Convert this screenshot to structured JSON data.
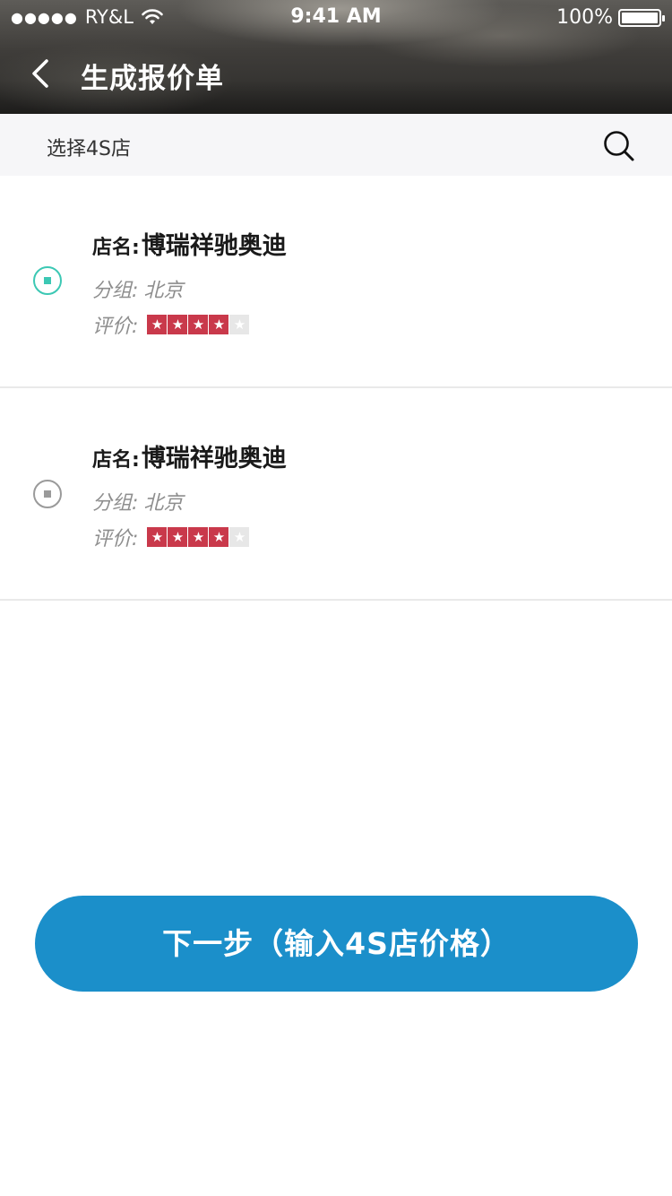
{
  "status_bar": {
    "signal_dots": "●●●●●",
    "carrier": "RY&L",
    "wifi_icon": "wifi-icon",
    "time": "9:41 AM",
    "battery_percent": "100%",
    "battery_level": 1.0
  },
  "nav": {
    "title": "生成报价单",
    "back_icon": "chevron-left-icon"
  },
  "search": {
    "label": "选择4S店",
    "icon": "search-icon"
  },
  "stores": [
    {
      "name_label": "店名:",
      "name": "博瑞祥驰奥迪",
      "group_label": "分组:",
      "group": "北京",
      "rating_label": "评价:",
      "rating": 4,
      "rating_max": 5,
      "selected": true
    },
    {
      "name_label": "店名:",
      "name": "博瑞祥驰奥迪",
      "group_label": "分组:",
      "group": "北京",
      "rating_label": "评价:",
      "rating": 4,
      "rating_max": 5,
      "selected": false
    }
  ],
  "next_button": {
    "label": "下一步（输入4S店价格）"
  },
  "colors": {
    "accent_button": "#1b8fca",
    "radio_selected": "#3cc8b4",
    "star_filled": "#c9394b",
    "star_empty": "#e7e7e7"
  }
}
